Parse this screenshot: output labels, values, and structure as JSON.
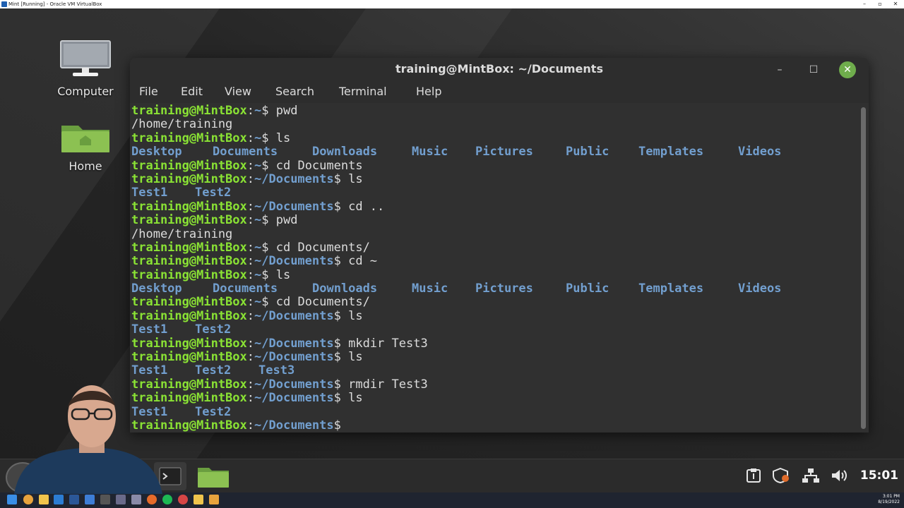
{
  "vbox": {
    "title": "Mint [Running] - Oracle VM VirtualBox",
    "minimize": "–",
    "restore": "▫",
    "close": "✕"
  },
  "desktop": {
    "icons": [
      {
        "label": "Computer",
        "icon": "computer-icon"
      },
      {
        "label": "Home",
        "icon": "home-folder-icon"
      }
    ]
  },
  "terminal": {
    "title": "training@MintBox: ~/Documents",
    "minimize": "–",
    "maximize": "☐",
    "close": "✕",
    "menu": [
      "File",
      "Edit",
      "View",
      "Search",
      "Terminal",
      "Help"
    ],
    "prompt_user": "training@MintBox",
    "lines": [
      {
        "type": "prompt",
        "path": "~",
        "cmd": "pwd"
      },
      {
        "type": "output",
        "text": "/home/training"
      },
      {
        "type": "prompt",
        "path": "~",
        "cmd": "ls"
      },
      {
        "type": "dirs",
        "items": [
          "Desktop",
          "Documents",
          "Downloads",
          "Music",
          "Pictures",
          "Public",
          "Templates",
          "Videos"
        ]
      },
      {
        "type": "prompt",
        "path": "~",
        "cmd": "cd Documents"
      },
      {
        "type": "prompt",
        "path": "~/Documents",
        "cmd": "ls"
      },
      {
        "type": "dirs",
        "items": [
          "Test1",
          "Test2"
        ]
      },
      {
        "type": "prompt",
        "path": "~/Documents",
        "cmd": "cd .."
      },
      {
        "type": "prompt",
        "path": "~",
        "cmd": "pwd"
      },
      {
        "type": "output",
        "text": "/home/training"
      },
      {
        "type": "prompt",
        "path": "~",
        "cmd": "cd Documents/"
      },
      {
        "type": "prompt",
        "path": "~/Documents",
        "cmd": "cd ~"
      },
      {
        "type": "prompt",
        "path": "~",
        "cmd": "ls"
      },
      {
        "type": "dirs",
        "items": [
          "Desktop",
          "Documents",
          "Downloads",
          "Music",
          "Pictures",
          "Public",
          "Templates",
          "Videos"
        ]
      },
      {
        "type": "prompt",
        "path": "~",
        "cmd": "cd Documents/"
      },
      {
        "type": "prompt",
        "path": "~/Documents",
        "cmd": "ls"
      },
      {
        "type": "dirs",
        "items": [
          "Test1",
          "Test2"
        ]
      },
      {
        "type": "prompt",
        "path": "~/Documents",
        "cmd": "mkdir Test3"
      },
      {
        "type": "prompt",
        "path": "~/Documents",
        "cmd": "ls"
      },
      {
        "type": "dirs",
        "items": [
          "Test1",
          "Test2",
          "Test3"
        ]
      },
      {
        "type": "prompt",
        "path": "~/Documents",
        "cmd": "rmdir Test3"
      },
      {
        "type": "prompt",
        "path": "~/Documents",
        "cmd": "ls"
      },
      {
        "type": "dirs",
        "items": [
          "Test1",
          "Test2"
        ]
      },
      {
        "type": "prompt",
        "path": "~/Documents",
        "cmd": ""
      }
    ]
  },
  "panel": {
    "clock": "15:01",
    "tray": [
      "clipboard-icon",
      "shield-update-icon",
      "network-icon",
      "volume-icon"
    ]
  },
  "host": {
    "time": "3:01 PM",
    "date": "8/19/2022"
  },
  "colors": {
    "prompt_user": "#8ae234",
    "prompt_path": "#729fcf",
    "directory": "#729fcf",
    "terminal_bg": "#303030",
    "mint_green": "#6fad4c"
  }
}
